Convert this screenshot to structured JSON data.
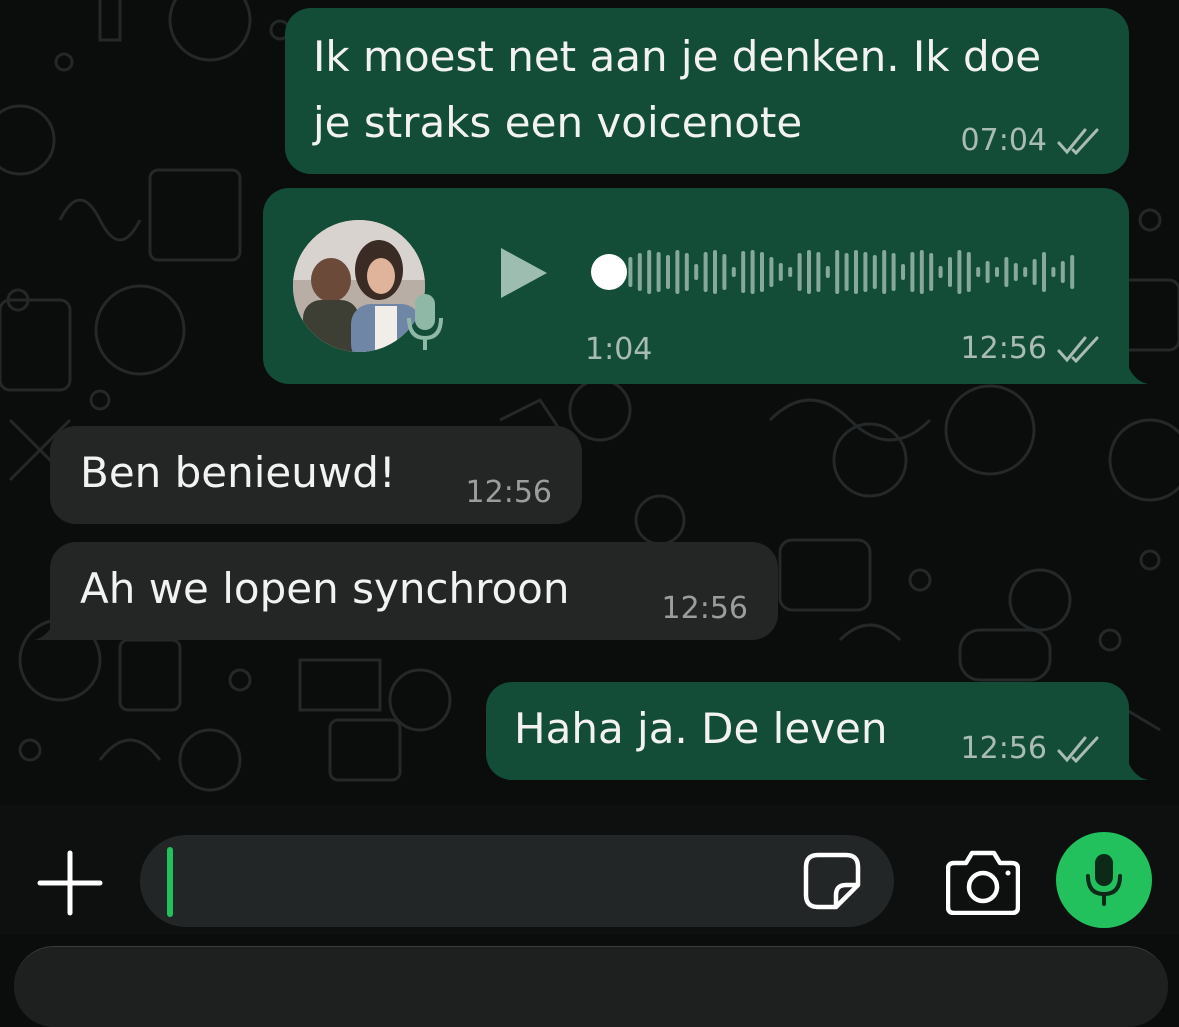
{
  "messages": [
    {
      "direction": "out",
      "type": "text",
      "lines": [
        "Ik moest net aan je denken. Ik doe",
        "je straks een voicenote"
      ],
      "time": "07:04",
      "status": "read-double-check"
    },
    {
      "direction": "out",
      "type": "voice",
      "duration": "1:04",
      "time": "12:56",
      "status": "read-double-check",
      "playback_progress": 0
    },
    {
      "direction": "in",
      "type": "text",
      "lines": [
        "Ben benieuwd!"
      ],
      "time": "12:56"
    },
    {
      "direction": "in",
      "type": "text",
      "lines": [
        "Ah we lopen synchroon"
      ],
      "time": "12:56"
    },
    {
      "direction": "out",
      "type": "text",
      "lines": [
        "Haha ja. De leven"
      ],
      "time": "12:56",
      "status": "read-double-check"
    }
  ],
  "input_bar": {
    "value": "",
    "icons": {
      "attach": "plus-icon",
      "sticker": "sticker-icon",
      "camera": "camera-icon",
      "voice": "microphone-icon"
    }
  },
  "colors": {
    "background": "#0b0c0c",
    "outgoing_bubble": "#134d37",
    "incoming_bubble": "#242626",
    "accent_green": "#22c15e",
    "timestamp_outgoing": "#a9bcb3"
  }
}
